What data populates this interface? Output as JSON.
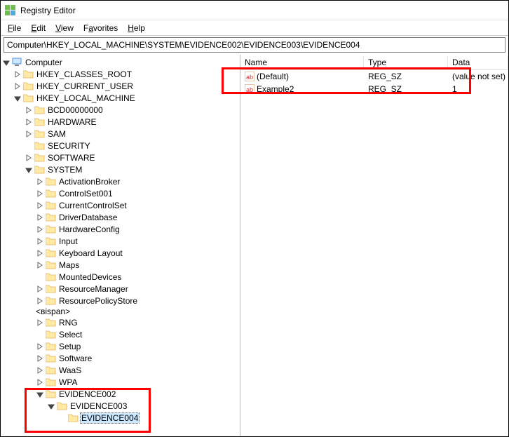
{
  "window": {
    "title": "Registry Editor"
  },
  "menu": {
    "file": "File",
    "edit": "Edit",
    "view": "View",
    "favorites": "Favorites",
    "help": "Help"
  },
  "address": "Computer\\HKEY_LOCAL_MACHINE\\SYSTEM\\EVIDENCE002\\EVIDENCE003\\EVIDENCE004",
  "columns": {
    "name": "Name",
    "type": "Type",
    "data": "Data"
  },
  "values": [
    {
      "name": "(Default)",
      "type": "REG_SZ",
      "data": "(value not set)"
    },
    {
      "name": "Example2",
      "type": "REG_SZ",
      "data": "1"
    }
  ],
  "tree": {
    "root": "Computer",
    "hkcr": "HKEY_CLASSES_ROOT",
    "hkcu": "HKEY_CURRENT_USER",
    "hklm": "HKEY_LOCAL_MACHINE",
    "bcd": "BCD00000000",
    "hardware": "HARDWARE",
    "sam": "SAM",
    "security": "SECURITY",
    "software": "SOFTWARE",
    "system": "SYSTEM",
    "activationbroker": "ActivationBroker",
    "controlset001": "ControlSet001",
    "currentcontrolset": "CurrentControlSet",
    "driverdatabase": "DriverDatabase",
    "hardwareconfig": "HardwareConfig",
    "input": "Input",
    "keyboardlayout": "Keyboard Layout",
    "maps": "Maps",
    "mounteddevices": "MountedDevices",
    "resourcemanager": "ResourceManager",
    "resourcepolicystore": "ResourcePolicyStore",
    "rng": "RNG",
    "select": "Select",
    "setup": "Setup",
    "softwarekey": "Software",
    "waas": "WaaS",
    "wpa": "WPA",
    "evidence002": "EVIDENCE002",
    "evidence003": "EVIDENCE003",
    "evidence004": "EVIDENCE004"
  }
}
